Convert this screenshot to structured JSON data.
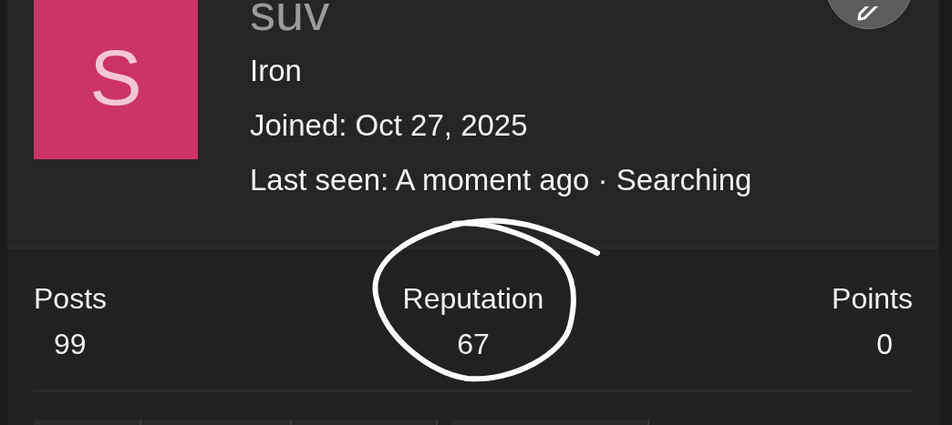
{
  "profile": {
    "avatar_letter": "S",
    "username": "suv",
    "rank": "Iron",
    "joined": "Joined: Oct 27, 2025",
    "last_seen": "Last seen: A moment ago · Searching"
  },
  "stats": [
    {
      "label": "Posts",
      "value": "99"
    },
    {
      "label": "Reputation",
      "value": "67"
    },
    {
      "label": "Points",
      "value": "0"
    }
  ]
}
